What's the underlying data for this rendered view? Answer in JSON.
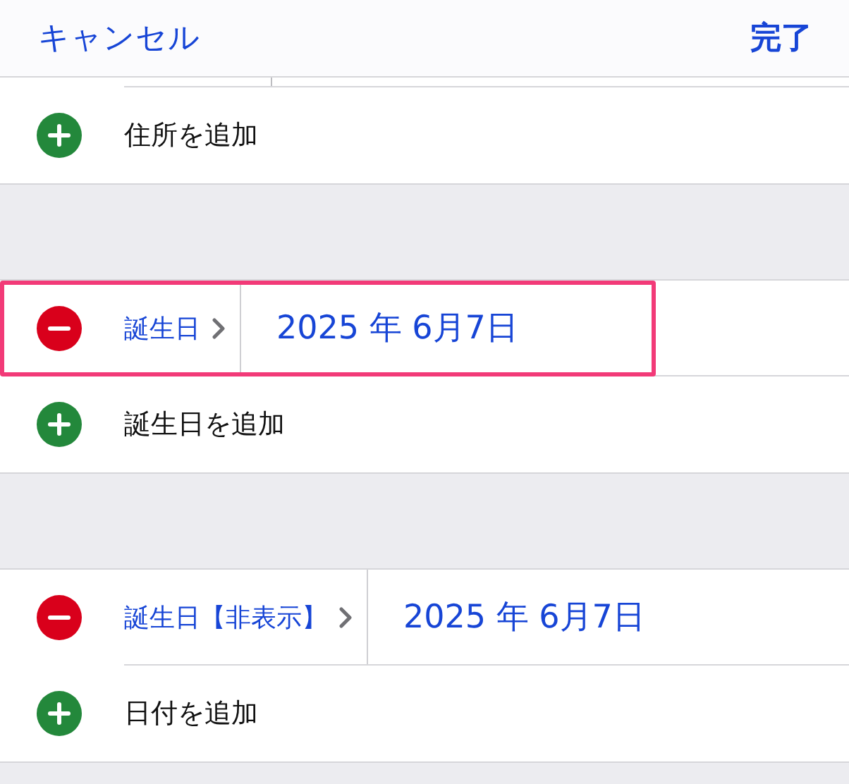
{
  "nav": {
    "cancel": "キャンセル",
    "done": "完了"
  },
  "sections": [
    {
      "rows": [
        {
          "kind": "add",
          "label": "住所を追加"
        }
      ]
    },
    {
      "rows": [
        {
          "kind": "field",
          "label": "誕生日",
          "value": "2025 年 6月7日",
          "highlighted": true
        },
        {
          "kind": "add",
          "label": "誕生日を追加"
        }
      ]
    },
    {
      "rows": [
        {
          "kind": "field",
          "label": "誕生日【非表示】",
          "value": "2025 年 6月7日",
          "highlighted": false
        },
        {
          "kind": "add",
          "label": "日付を追加"
        }
      ]
    }
  ]
}
